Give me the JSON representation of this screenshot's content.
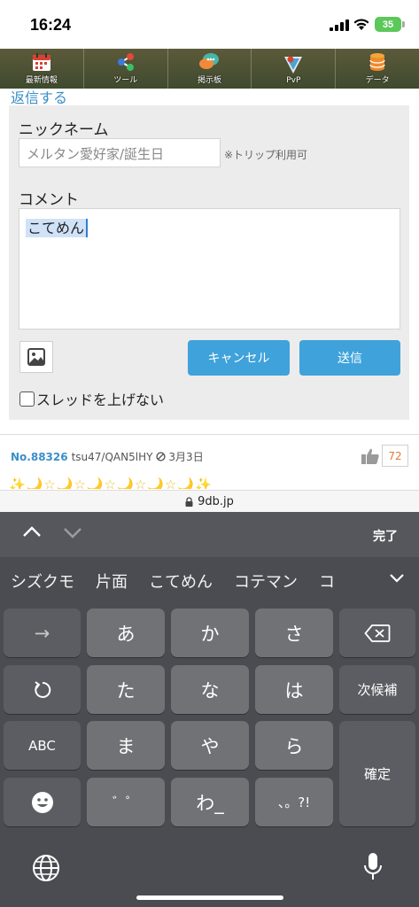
{
  "status": {
    "time": "16:24",
    "battery": "35"
  },
  "site_nav": {
    "items": [
      {
        "label": "最新情報",
        "icon": "calendar-icon"
      },
      {
        "label": "ツール",
        "icon": "share-nodes-icon"
      },
      {
        "label": "掲示板",
        "icon": "chat-bubbles-icon"
      },
      {
        "label": "PvP",
        "icon": "pvp-shield-icon"
      },
      {
        "label": "データ",
        "icon": "database-icon"
      }
    ]
  },
  "reply": {
    "title": "返信する"
  },
  "form": {
    "nickname_label": "ニックネーム",
    "nickname_placeholder": "メルタン愛好家/誕生日",
    "trip_note": "※トリップ利用可",
    "comment_label": "コメント",
    "comment_value": "こてめん",
    "cancel_label": "キャンセル",
    "send_label": "送信",
    "no_bump_label": "スレッドを上げない"
  },
  "post": {
    "number": "No.88326",
    "user_id": "tsu47/QAN5lHY",
    "date": "3月3日",
    "like_count": "72"
  },
  "url_bar": {
    "domain": "9db.jp"
  },
  "keyboard": {
    "done_label": "完了",
    "suggestions": [
      "シズクモ",
      "片面",
      "こてめん",
      "コテマン",
      "コ"
    ],
    "keys": {
      "a": "あ",
      "ka": "か",
      "sa": "さ",
      "ta": "た",
      "na": "な",
      "ha": "は",
      "ma": "ま",
      "ya": "や",
      "ra": "ら",
      "dakuten": "゛゜",
      "wa": "わ_",
      "punct": "、。?!",
      "next_candidate": "次候補",
      "abc": "ABC",
      "confirm": "確定",
      "arrow": "→"
    }
  }
}
